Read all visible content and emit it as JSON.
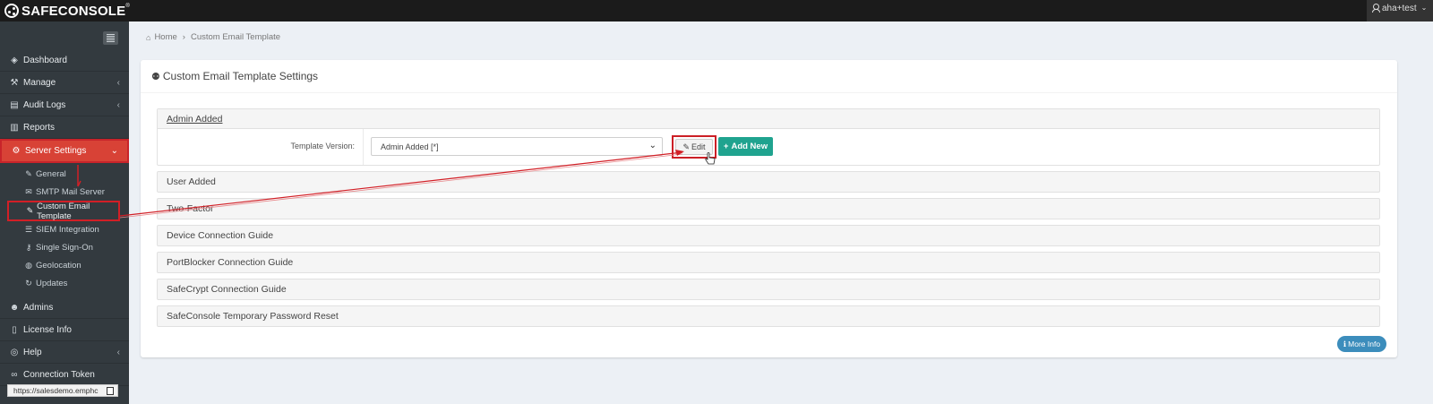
{
  "brand": {
    "name": "SAFECONSOLE",
    "mark": "®"
  },
  "user": {
    "name": "aha+test",
    "caret": "⌄"
  },
  "sidebar": {
    "items": [
      {
        "label": "Dashboard",
        "icon": "dashboard-icon",
        "glyph": "◈"
      },
      {
        "label": "Manage",
        "icon": "wrench-icon",
        "glyph": "🔧",
        "chevron": "‹"
      },
      {
        "label": "Audit Logs",
        "icon": "book-icon",
        "glyph": "▤",
        "chevron": "‹"
      },
      {
        "label": "Reports",
        "icon": "bar-chart-icon",
        "glyph": "▥"
      },
      {
        "label": "Server Settings",
        "icon": "cogs-icon",
        "glyph": "⚙",
        "chevron": "⌄"
      },
      {
        "label": "Admins",
        "icon": "users-icon",
        "glyph": "👥"
      },
      {
        "label": "License Info",
        "icon": "file-icon",
        "glyph": "▯"
      },
      {
        "label": "Help",
        "icon": "lifebuoy-icon",
        "glyph": "◎",
        "chevron": "‹"
      },
      {
        "label": "Connection Token",
        "icon": "link-icon",
        "glyph": "∞"
      }
    ],
    "subitems": [
      {
        "label": "General",
        "glyph": "✎"
      },
      {
        "label": "SMTP Mail Server",
        "glyph": "✉"
      },
      {
        "label": "Custom Email Template",
        "glyph": "✎"
      },
      {
        "label": "SIEM Integration",
        "glyph": "☰"
      },
      {
        "label": "Single Sign-On",
        "glyph": "⚷"
      },
      {
        "label": "Geolocation",
        "glyph": "◍"
      },
      {
        "label": "Updates",
        "glyph": "↻"
      }
    ]
  },
  "breadcrumb": {
    "home": "Home",
    "separator": "›",
    "current": "Custom Email Template"
  },
  "page": {
    "title": "Custom Email Template Settings",
    "title_icon_glyph": "⚉"
  },
  "open_panel": {
    "title": "Admin Added",
    "template_version_label": "Template Version:",
    "template_version_value": "Admin Added [*]",
    "edit_label": "Edit",
    "edit_glyph": "✎",
    "add_new_label": "Add New",
    "add_new_glyph": "+"
  },
  "panels": [
    "User Added",
    "Two-Factor",
    "Device Connection Guide",
    "PortBlocker Connection Guide",
    "SafeCrypt Connection Guide",
    "SafeConsole Temporary Password Reset"
  ],
  "more_info": {
    "label": "More Info",
    "glyph": "ℹ"
  },
  "statusbar": {
    "url": "https://salesdemo.emphc"
  },
  "colors": {
    "topbar": "#1b1b1b",
    "sidebar": "#333a3f",
    "active": "#d84236",
    "annotation": "#d21f26",
    "add_new": "#1fa38f",
    "more_info": "#3c8dbc"
  }
}
